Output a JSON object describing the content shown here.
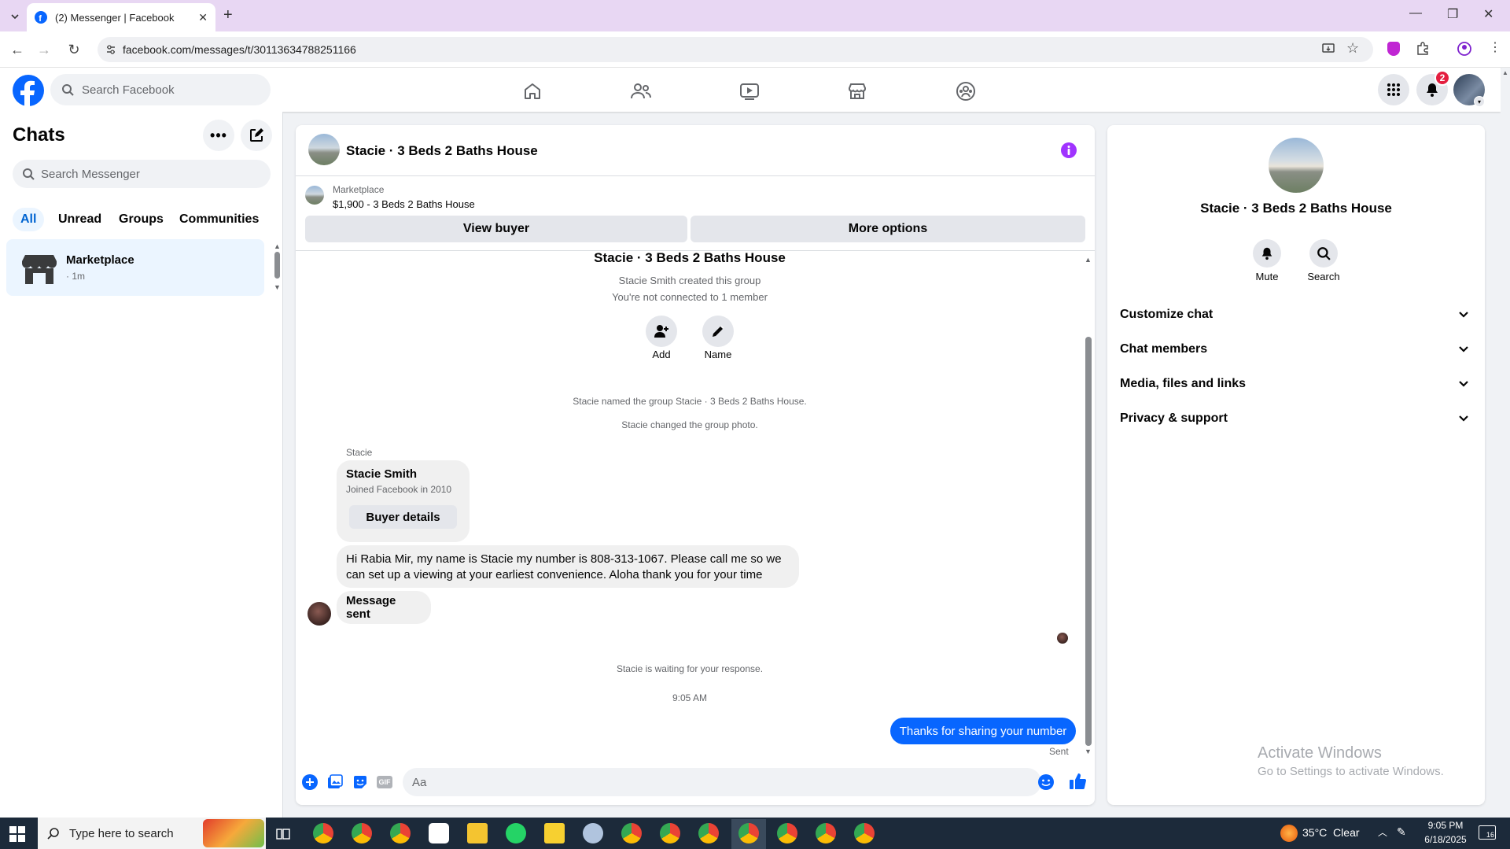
{
  "browser": {
    "tab_title": "(2) Messenger | Facebook",
    "url": "facebook.com/messages/t/30113634788251166"
  },
  "fb_header": {
    "search_placeholder": "Search Facebook",
    "notification_count": "2"
  },
  "left": {
    "title": "Chats",
    "search_placeholder": "Search Messenger",
    "filters": [
      "All",
      "Unread",
      "Groups",
      "Communities"
    ],
    "chat": {
      "name": "Marketplace",
      "time": "· 1m"
    }
  },
  "conversation": {
    "title": "Stacie · 3 Beds 2 Baths House",
    "listing_label": "Marketplace",
    "listing_detail": "$1,900 - 3 Beds 2 Baths House",
    "view_buyer": "View buyer",
    "more_options": "More options",
    "group_title": "Stacie · 3 Beds 2 Baths House",
    "created": "Stacie Smith created this group",
    "not_connected": "You're not connected to 1 member",
    "add_label": "Add",
    "name_label": "Name",
    "event_named": "Stacie named the group Stacie · 3 Beds 2 Baths House.",
    "event_photo": "Stacie changed the group photo.",
    "sender": "Stacie",
    "card_name": "Stacie Smith",
    "card_joined": "Joined Facebook in 2010",
    "buyer_details": "Buyer details",
    "message_1": "Hi Rabia Mir, my name is Stacie my number is 808-313-1067. Please call me so we can set up a viewing at your earliest convenience. Aloha thank you for your time",
    "message_2": "Message sent",
    "waiting": "Stacie is waiting for your response.",
    "timestamp": "9:05 AM",
    "my_message": "Thanks for sharing your number",
    "status": "Sent",
    "composer_placeholder": "Aa"
  },
  "info": {
    "name": "Stacie · 3 Beds 2 Baths House",
    "mute": "Mute",
    "search": "Search",
    "sections": [
      "Customize chat",
      "Chat members",
      "Media, files and links",
      "Privacy & support"
    ],
    "watermark_title": "Activate Windows",
    "watermark_sub": "Go to Settings to activate Windows."
  },
  "taskbar": {
    "search_placeholder": "Type here to search",
    "weather": "35°C  Clear",
    "time": "9:05 PM",
    "date": "6/18/2025",
    "notif": "16"
  },
  "colors": {
    "fb_blue": "#0866ff",
    "chrome_tab_strip": "#e8d7f3",
    "purple_accent": "#a033ff"
  }
}
